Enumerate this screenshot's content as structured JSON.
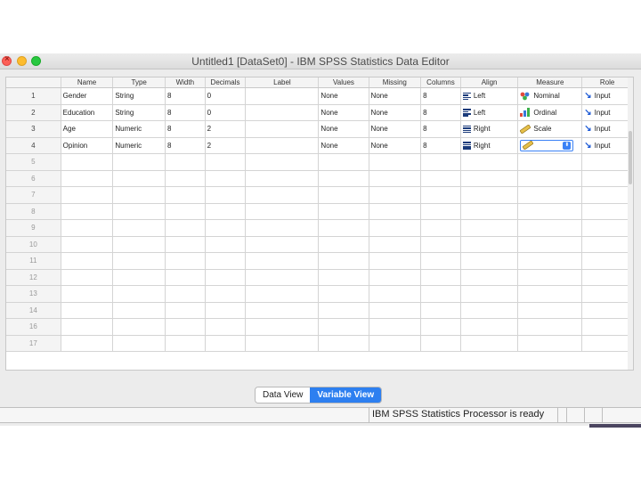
{
  "window": {
    "title": "Untitled1 [DataSet0] - IBM SPSS Statistics Data Editor"
  },
  "grid": {
    "headers": [
      "Name",
      "Type",
      "Width",
      "Decimals",
      "Label",
      "Values",
      "Missing",
      "Columns",
      "Align",
      "Measure",
      "Role"
    ],
    "variables": [
      {
        "row": "1",
        "name": "Gender",
        "type": "String",
        "width": "8",
        "decimals": "0",
        "label": "",
        "values": "None",
        "missing": "None",
        "columns": "8",
        "align": "Left",
        "align_icon": "align-left-icon",
        "measure": "Nominal",
        "measure_icon": "nominal-icon",
        "role": "Input"
      },
      {
        "row": "2",
        "name": "Education",
        "type": "String",
        "width": "8",
        "decimals": "0",
        "label": "",
        "values": "None",
        "missing": "None",
        "columns": "8",
        "align": "Left",
        "align_icon": "align-left-icon",
        "measure": "Ordinal",
        "measure_icon": "ordinal-icon",
        "role": "Input"
      },
      {
        "row": "3",
        "name": "Age",
        "type": "Numeric",
        "width": "8",
        "decimals": "2",
        "label": "",
        "values": "None",
        "missing": "None",
        "columns": "8",
        "align": "Right",
        "align_icon": "align-right-icon",
        "measure": "Scale",
        "measure_icon": "scale-icon",
        "role": "Input"
      },
      {
        "row": "4",
        "name": "Opinion",
        "type": "Numeric",
        "width": "8",
        "decimals": "2",
        "label": "",
        "values": "None",
        "missing": "None",
        "columns": "8",
        "align": "Right",
        "align_icon": "align-right-icon",
        "measure": "",
        "measure_icon": "scale-icon",
        "role": "Input"
      }
    ],
    "empty_rows": [
      "5",
      "6",
      "7",
      "8",
      "9",
      "10",
      "11",
      "12",
      "13",
      "14",
      "16",
      "17"
    ]
  },
  "tabs": {
    "data_view": "Data View",
    "variable_view": "Variable View",
    "active": "variable_view"
  },
  "status": {
    "processor": "IBM SPSS Statistics Processor is ready"
  },
  "colors": {
    "accent": "#2d7ff0",
    "role_arrow": "#1f5bd6"
  }
}
